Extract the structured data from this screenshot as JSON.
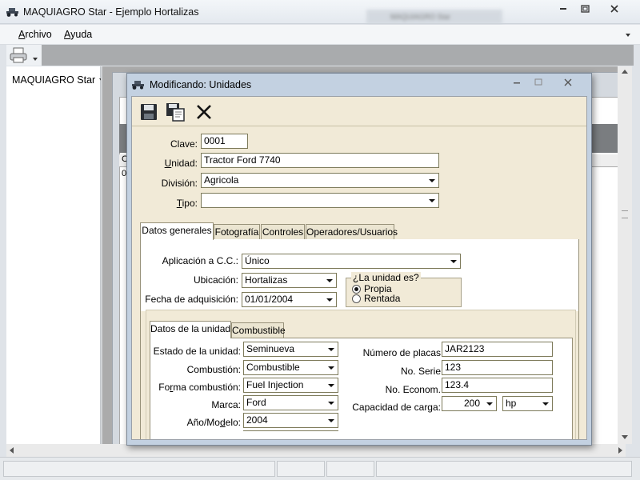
{
  "app": {
    "title": "MAQUIAGRO Star - Ejemplo Hortalizas",
    "ghost_title": "MAQUIAGRO Star"
  },
  "menu": {
    "archivo": "Archivo",
    "ayuda": "Ayuda"
  },
  "sidebar": {
    "item": "MAQUIAGRO Star"
  },
  "background_window": {
    "header_cell": "C",
    "row_cell": "0"
  },
  "dialog": {
    "title": "Modificando: Unidades",
    "toolbar_icons": [
      "save-icon",
      "save-as-icon",
      "cancel-icon"
    ],
    "fields": {
      "clave_label": "Clave:",
      "clave_value": "0001",
      "unidad_label": "Unidad:",
      "unidad_value": "Tractor Ford 7740",
      "division_label": "División:",
      "division_value": "Agricola",
      "tipo_label": "Tipo:",
      "tipo_value": ""
    },
    "tabs": [
      "Datos generales",
      "Fotografía",
      "Controles",
      "Operadores/Usuarios"
    ],
    "general": {
      "aplicacion_label": "Aplicación a C.C.:",
      "aplicacion_value": "Único",
      "ubicacion_label": "Ubicación:",
      "ubicacion_value": "Hortalizas",
      "fecha_label": "Fecha de adquisición:",
      "fecha_value": "01/01/2004",
      "unidad_es_title": "¿La unidad es?",
      "radio_propia": "Propia",
      "radio_rentada": "Rentada",
      "selected": "Propia"
    },
    "subtabs": [
      "Datos de la unidad",
      "Combustible"
    ],
    "unit_data": {
      "estado_label": "Estado de la unidad:",
      "estado_value": "Seminueva",
      "combustion_label": "Combustión:",
      "combustion_value": "Combustible",
      "forma_label": "Forma combustión:",
      "forma_value": "Fuel Injection",
      "marca_label": "Marca:",
      "marca_value": "Ford",
      "anio_label": "Año/Modelo:",
      "anio_value": "2004",
      "placas_label": "Número de placas",
      "placas_value": "JAR2123",
      "serie_label": "No. Serie",
      "serie_value": "123",
      "econom_label": "No. Econom.",
      "econom_value": "123.4",
      "capacidad_label": "Capacidad de carga:",
      "capacidad_value": "200",
      "capacidad_unit": "hp"
    }
  },
  "colors": {
    "dialog_frame": "#c3d1e1",
    "dialog_body": "#f1ead7",
    "field_border": "#7d7a5a"
  }
}
